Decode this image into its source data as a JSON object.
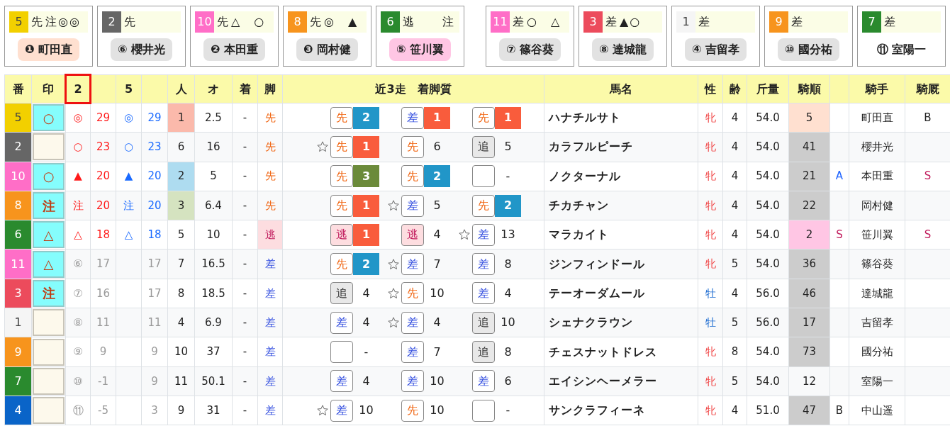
{
  "card_groups": [
    [
      {
        "number": "5",
        "color": "#f2d000",
        "pale": true,
        "style": "先",
        "marks": "注◎◎",
        "jockey": {
          "text": "❶ 町田直",
          "color": "#ffe0d0"
        }
      },
      {
        "number": "2",
        "color": "#666666",
        "pale": false,
        "style": "先",
        "jockey": {
          "text": "⑥ 櫻井光",
          "color": "#e2e2e2"
        }
      },
      {
        "number": "10",
        "color": "#ff6ec7",
        "pale": false,
        "style": "先",
        "marks": "△　○",
        "jockey": {
          "text": "❷ 本田重",
          "color": "#e2e2e2"
        }
      },
      {
        "number": "8",
        "color": "#f7941d",
        "pale": false,
        "style": "先",
        "marks": "◎　▲",
        "jockey": {
          "text": "❸ 岡村健",
          "color": "#e2e2e2"
        }
      },
      {
        "number": "6",
        "color": "#2a8a2e",
        "pale": false,
        "style": "逃",
        "marks": "注",
        "marks_right": true,
        "jockey": {
          "text": "⑤ 笹川翼",
          "color": "#ffc6e4"
        }
      }
    ],
    [
      {
        "number": "11",
        "color": "#ff6ec7",
        "pale": false,
        "style": "差",
        "marks": "○　△",
        "jockey": {
          "text": "⑦ 篠谷葵",
          "color": "#e2e2e2"
        }
      },
      {
        "number": "3",
        "color": "#ec4b5c",
        "pale": false,
        "style": "差",
        "marks": "▲○",
        "jockey": {
          "text": "⑧ 達城龍",
          "color": "#e2e2e2"
        }
      },
      {
        "number": "1",
        "color": "#f5f5f5",
        "pale": true,
        "style": "差",
        "jockey": {
          "text": "④ 吉留孝",
          "color": "#e2e2e2"
        }
      },
      {
        "number": "9",
        "color": "#f7941d",
        "pale": false,
        "style": "差",
        "jockey": {
          "text": "⑩ 國分祐",
          "color": "#e2e2e2"
        }
      },
      {
        "number": "7",
        "color": "#2a8a2e",
        "pale": false,
        "style": "差",
        "jockey": {
          "text": "⑪ 室陽一"
        }
      }
    ]
  ],
  "table": {
    "columns": [
      {
        "label": "番",
        "selected": false
      },
      {
        "label": "印",
        "selected": false
      },
      {
        "label": "2",
        "selected": true
      },
      {
        "selected": false
      },
      {
        "label": "5",
        "selected": false
      },
      {
        "selected": false
      },
      {
        "label": "人",
        "selected": false
      },
      {
        "label": "オ",
        "selected": false
      },
      {
        "label": "着",
        "selected": false
      },
      {
        "label": "脚",
        "selected": false
      },
      {
        "label": "近3走　着脚質",
        "selected": false
      },
      {
        "label": "馬名",
        "selected": false
      },
      {
        "label": "性",
        "selected": false
      },
      {
        "label": "齢",
        "selected": false
      },
      {
        "label": "斤量",
        "selected": false
      },
      {
        "label": "騎順",
        "selected": false
      },
      {
        "selected": false
      },
      {
        "label": "騎手",
        "selected": false
      },
      {
        "label": "騎厩",
        "selected": false
      }
    ],
    "rows": [
      {
        "number": "5",
        "color": "#f2d000",
        "pale": true,
        "mark": "○",
        "pick_dim": false,
        "pick2": {
          "symbol": "◎",
          "value": "29"
        },
        "pick5": {
          "symbol": "◎",
          "value": "29"
        },
        "popularity": {
          "text": "1",
          "color": "#fbb9ab"
        },
        "odds": "2.5",
        "finish": "-",
        "leg": {
          "text": "先",
          "kind": "front"
        },
        "recent": [
          {
            "star": false,
            "style": {
              "text": "先",
              "kind": "front"
            },
            "finish": {
              "text": "2",
              "color": "#2196c8"
            }
          },
          {
            "star": false,
            "style": {
              "text": "差",
              "kind": "closer"
            },
            "finish": {
              "text": "1",
              "color": "#f95c3c"
            }
          },
          {
            "star": false,
            "style": {
              "text": "先",
              "kind": "front"
            },
            "finish": {
              "text": "1",
              "color": "#f95c3c"
            }
          }
        ],
        "name": "ハナチルサト",
        "sex": {
          "text": "牝",
          "kind": "female"
        },
        "age": "4",
        "weight": "54.0",
        "order": {
          "text": "5",
          "color": "#ffe0d0"
        },
        "jockey": "町田直",
        "stable": {
          "text": "B",
          "color": "#222222"
        }
      },
      {
        "number": "2",
        "color": "#666666",
        "pale": false,
        "pick_dim": false,
        "pick2": {
          "symbol": "○",
          "value": "23"
        },
        "pick5": {
          "symbol": "○",
          "value": "23"
        },
        "popularity": {
          "text": "6"
        },
        "odds": "16",
        "finish": "-",
        "leg": {
          "text": "先",
          "kind": "front"
        },
        "recent": [
          {
            "star": true,
            "style": {
              "text": "先",
              "kind": "front"
            },
            "finish": {
              "text": "1",
              "color": "#f95c3c"
            }
          },
          {
            "star": false,
            "style": {
              "text": "先",
              "kind": "front"
            },
            "finish": {
              "text": "6"
            }
          },
          {
            "star": false,
            "style": {
              "text": "追",
              "kind": "rear"
            },
            "finish": {
              "text": "5"
            }
          }
        ],
        "name": "カラフルピーチ",
        "sex": {
          "text": "牝",
          "kind": "female"
        },
        "age": "4",
        "weight": "54.0",
        "order": {
          "text": "41",
          "color": "#cccccc"
        },
        "jockey": "櫻井光"
      },
      {
        "number": "10",
        "color": "#ff6ec7",
        "pale": false,
        "mark": "○",
        "pick_dim": false,
        "pick2": {
          "symbol": "▲",
          "value": "20"
        },
        "pick5": {
          "symbol": "▲",
          "value": "20"
        },
        "popularity": {
          "text": "2",
          "color": "#aedcf0"
        },
        "odds": "5",
        "finish": "-",
        "leg": {
          "text": "先",
          "kind": "front"
        },
        "recent": [
          {
            "star": false,
            "style": {
              "text": "先",
              "kind": "front"
            },
            "finish": {
              "text": "3",
              "color": "#6b8a3a"
            }
          },
          {
            "star": false,
            "style": {
              "text": "先",
              "kind": "front"
            },
            "finish": {
              "text": "2",
              "color": "#2196c8"
            }
          },
          {
            "star": false,
            "style": {
              "kind": "blank"
            },
            "finish": {
              "text": "-"
            }
          }
        ],
        "name": "ノクターナル",
        "sex": {
          "text": "牝",
          "kind": "female"
        },
        "age": "4",
        "weight": "54.0",
        "order": {
          "text": "21",
          "color": "#cccccc"
        },
        "letter": {
          "text": "A",
          "color": "#2266ff"
        },
        "jockey": "本田重",
        "stable": {
          "text": "S",
          "color": "#c0185a"
        }
      },
      {
        "number": "8",
        "color": "#f7941d",
        "pale": false,
        "mark": "注",
        "pick_dim": false,
        "pick2": {
          "symbol": "注",
          "value": "20"
        },
        "pick5": {
          "symbol": "注",
          "value": "20"
        },
        "popularity": {
          "text": "3",
          "color": "#d5e3c0"
        },
        "odds": "6.4",
        "finish": "-",
        "leg": {
          "text": "先",
          "kind": "front"
        },
        "recent": [
          {
            "star": false,
            "style": {
              "text": "先",
              "kind": "front"
            },
            "finish": {
              "text": "1",
              "color": "#f95c3c"
            }
          },
          {
            "star": true,
            "style": {
              "text": "差",
              "kind": "closer"
            },
            "finish": {
              "text": "5"
            }
          },
          {
            "star": false,
            "style": {
              "text": "先",
              "kind": "front"
            },
            "finish": {
              "text": "2",
              "color": "#2196c8"
            }
          }
        ],
        "name": "チカチャン",
        "sex": {
          "text": "牝",
          "kind": "female"
        },
        "age": "4",
        "weight": "54.0",
        "order": {
          "text": "22",
          "color": "#cccccc"
        },
        "jockey": "岡村健"
      },
      {
        "number": "6",
        "color": "#2a8a2e",
        "pale": false,
        "mark": "△",
        "pick_dim": false,
        "pick2": {
          "symbol": "△",
          "value": "18"
        },
        "pick5": {
          "symbol": "△",
          "value": "18"
        },
        "popularity": {
          "text": "5"
        },
        "odds": "10",
        "finish": "-",
        "leg": {
          "text": "逃",
          "kind": "escape"
        },
        "recent": [
          {
            "star": false,
            "style": {
              "text": "逃",
              "kind": "escape"
            },
            "finish": {
              "text": "1",
              "color": "#f95c3c"
            }
          },
          {
            "star": false,
            "style": {
              "text": "逃",
              "kind": "escape"
            },
            "finish": {
              "text": "4"
            }
          },
          {
            "star": true,
            "style": {
              "text": "差",
              "kind": "closer"
            },
            "finish": {
              "text": "13"
            }
          }
        ],
        "name": "マラカイト",
        "sex": {
          "text": "牝",
          "kind": "female"
        },
        "age": "4",
        "weight": "54.0",
        "order": {
          "text": "2",
          "color": "#ffc6e4"
        },
        "letter": {
          "text": "S",
          "color": "#c0185a"
        },
        "jockey": "笹川翼",
        "stable": {
          "text": "S",
          "color": "#c0185a"
        }
      },
      {
        "number": "11",
        "color": "#ff6ec7",
        "pale": false,
        "mark": "△",
        "pick_dim": true,
        "pick2": {
          "symbol": "⑥",
          "value": "17"
        },
        "pick5": {
          "value": "17"
        },
        "popularity": {
          "text": "7"
        },
        "odds": "16.5",
        "finish": "-",
        "leg": {
          "text": "差",
          "kind": "closer"
        },
        "recent": [
          {
            "star": false,
            "style": {
              "text": "先",
              "kind": "front"
            },
            "finish": {
              "text": "2",
              "color": "#2196c8"
            }
          },
          {
            "star": true,
            "style": {
              "text": "差",
              "kind": "closer"
            },
            "finish": {
              "text": "7"
            }
          },
          {
            "star": false,
            "style": {
              "text": "差",
              "kind": "closer"
            },
            "finish": {
              "text": "8"
            }
          }
        ],
        "name": "ジンフィンドール",
        "sex": {
          "text": "牝",
          "kind": "female"
        },
        "age": "5",
        "weight": "54.0",
        "order": {
          "text": "36",
          "color": "#cccccc"
        },
        "jockey": "篠谷葵"
      },
      {
        "number": "3",
        "color": "#ec4b5c",
        "pale": false,
        "mark": "注",
        "pick_dim": true,
        "pick2": {
          "symbol": "⑦",
          "value": "16"
        },
        "pick5": {
          "value": "17"
        },
        "popularity": {
          "text": "8"
        },
        "odds": "18.5",
        "finish": "-",
        "leg": {
          "text": "差",
          "kind": "closer"
        },
        "recent": [
          {
            "star": false,
            "style": {
              "text": "追",
              "kind": "rear"
            },
            "finish": {
              "text": "4"
            }
          },
          {
            "star": true,
            "style": {
              "text": "先",
              "kind": "front"
            },
            "finish": {
              "text": "10"
            }
          },
          {
            "star": false,
            "style": {
              "text": "差",
              "kind": "closer"
            },
            "finish": {
              "text": "4"
            }
          }
        ],
        "name": "テーオーダムール",
        "sex": {
          "text": "牡",
          "kind": "male"
        },
        "age": "4",
        "weight": "56.0",
        "order": {
          "text": "46",
          "color": "#cccccc"
        },
        "jockey": "達城龍"
      },
      {
        "number": "1",
        "color": "#f5f5f5",
        "pale": true,
        "pick_dim": true,
        "pick2": {
          "symbol": "⑧",
          "value": "11"
        },
        "pick5": {
          "value": "11"
        },
        "popularity": {
          "text": "4"
        },
        "odds": "6.9",
        "finish": "-",
        "leg": {
          "text": "差",
          "kind": "closer"
        },
        "recent": [
          {
            "star": false,
            "style": {
              "text": "差",
              "kind": "closer"
            },
            "finish": {
              "text": "4"
            }
          },
          {
            "star": true,
            "style": {
              "text": "差",
              "kind": "closer"
            },
            "finish": {
              "text": "4"
            }
          },
          {
            "star": false,
            "style": {
              "text": "追",
              "kind": "rear"
            },
            "finish": {
              "text": "10"
            }
          }
        ],
        "name": "シェナクラウン",
        "sex": {
          "text": "牡",
          "kind": "male"
        },
        "age": "5",
        "weight": "56.0",
        "order": {
          "text": "17",
          "color": "#cccccc"
        },
        "jockey": "吉留孝"
      },
      {
        "number": "9",
        "color": "#f7941d",
        "pale": false,
        "pick_dim": true,
        "pick2": {
          "symbol": "⑨",
          "value": "9"
        },
        "pick5": {
          "value": "9"
        },
        "popularity": {
          "text": "10"
        },
        "odds": "37",
        "finish": "-",
        "leg": {
          "text": "差",
          "kind": "closer"
        },
        "recent": [
          {
            "star": false,
            "style": {
              "kind": "blank"
            },
            "finish": {
              "text": "-"
            }
          },
          {
            "star": false,
            "style": {
              "text": "差",
              "kind": "closer"
            },
            "finish": {
              "text": "7"
            }
          },
          {
            "star": false,
            "style": {
              "text": "追",
              "kind": "rear"
            },
            "finish": {
              "text": "8"
            }
          }
        ],
        "name": "チェスナットドレス",
        "sex": {
          "text": "牝",
          "kind": "female"
        },
        "age": "8",
        "weight": "54.0",
        "order": {
          "text": "73",
          "color": "#cccccc"
        },
        "jockey": "國分祐"
      },
      {
        "number": "7",
        "color": "#2a8a2e",
        "pale": false,
        "pick_dim": true,
        "pick2": {
          "symbol": "⑩",
          "value": "-1"
        },
        "pick5": {
          "value": "9"
        },
        "popularity": {
          "text": "11"
        },
        "odds": "50.1",
        "finish": "-",
        "leg": {
          "text": "差",
          "kind": "closer"
        },
        "recent": [
          {
            "star": false,
            "style": {
              "text": "差",
              "kind": "closer"
            },
            "finish": {
              "text": "4"
            }
          },
          {
            "star": false,
            "style": {
              "text": "差",
              "kind": "closer"
            },
            "finish": {
              "text": "10"
            }
          },
          {
            "star": false,
            "style": {
              "text": "差",
              "kind": "closer"
            },
            "finish": {
              "text": "6"
            }
          }
        ],
        "name": "エイシンヘーメラー",
        "sex": {
          "text": "牝",
          "kind": "female"
        },
        "age": "5",
        "weight": "54.0",
        "order": {
          "text": "12"
        },
        "jockey": "室陽一"
      },
      {
        "number": "4",
        "color": "#0a64c8",
        "pale": false,
        "pick_dim": true,
        "pick2": {
          "symbol": "⑪",
          "value": "-5"
        },
        "pick5": {
          "value": "3"
        },
        "popularity": {
          "text": "9"
        },
        "odds": "31",
        "finish": "-",
        "leg": {
          "text": "差",
          "kind": "closer"
        },
        "recent": [
          {
            "star": true,
            "style": {
              "text": "差",
              "kind": "closer"
            },
            "finish": {
              "text": "10"
            }
          },
          {
            "star": false,
            "style": {
              "text": "先",
              "kind": "front"
            },
            "finish": {
              "text": "10"
            }
          },
          {
            "star": false,
            "style": {
              "kind": "blank"
            },
            "finish": {
              "text": "-"
            }
          }
        ],
        "name": "サンクラフィーネ",
        "sex": {
          "text": "牝",
          "kind": "female"
        },
        "age": "4",
        "weight": "51.0",
        "order": {
          "text": "47",
          "color": "#cccccc"
        },
        "letter": {
          "text": "B",
          "color": "#222222"
        },
        "jockey": "中山遥"
      }
    ]
  }
}
